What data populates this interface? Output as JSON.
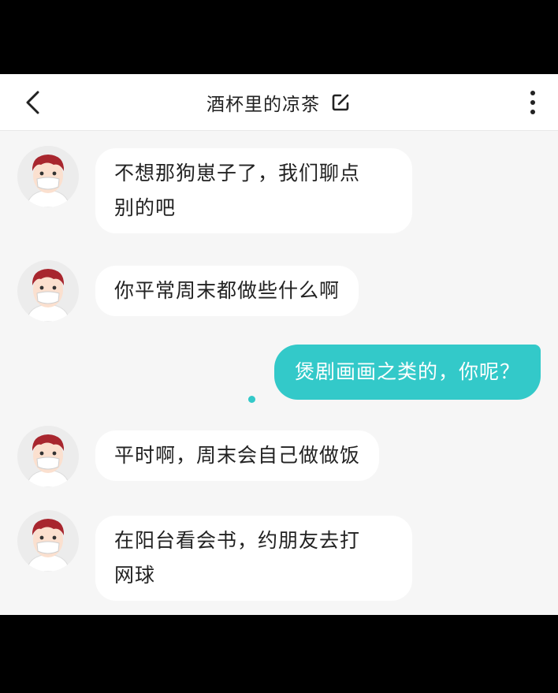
{
  "header": {
    "title": "酒杯里的凉茶",
    "back_icon": "chevron-left-icon",
    "edit_icon": "edit-icon",
    "more_icon": "more-vertical-icon"
  },
  "colors": {
    "accent": "#33c9c9",
    "incoming_bubble": "#ffffff",
    "background": "#f6f6f6"
  },
  "messages": [
    {
      "direction": "in",
      "line1": "不想那狗崽子了，我们聊点",
      "line2": "别的吧"
    },
    {
      "direction": "in",
      "text": "你平常周末都做些什么啊"
    },
    {
      "direction": "out",
      "text": "煲剧画画之类的，你呢？"
    },
    {
      "direction": "in",
      "text": "平时啊，周末会自己做做饭"
    },
    {
      "direction": "in",
      "line1": "在阳台看会书，约朋友去打",
      "line2": "网球"
    }
  ]
}
